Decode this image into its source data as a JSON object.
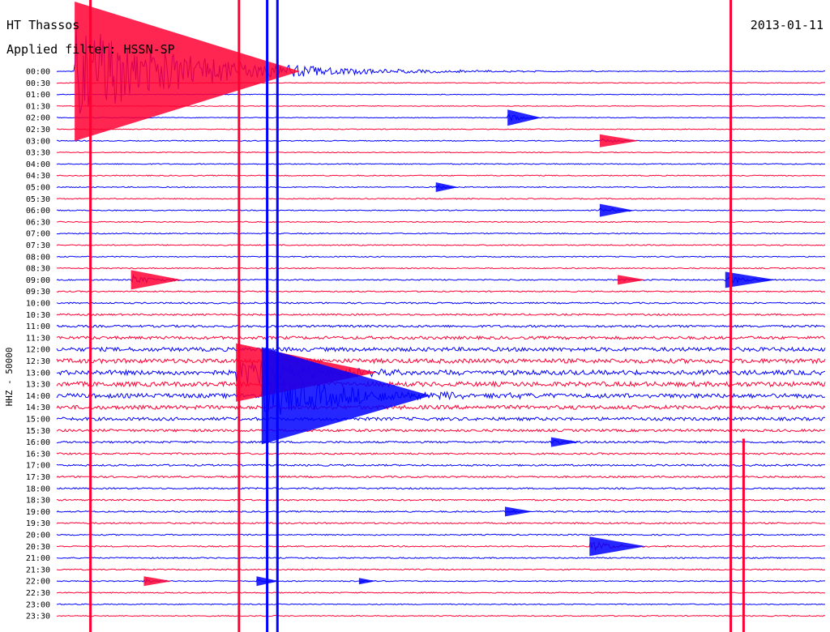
{
  "chart_data": {
    "type": "line",
    "title": "HT Thassos",
    "date": "2013-01-11",
    "filter_label": "Applied filter: HSSN-SP",
    "ylabel": "HHZ - 50000",
    "row_labels": [
      "00:00",
      "00:30",
      "01:00",
      "01:30",
      "02:00",
      "02:30",
      "03:00",
      "03:30",
      "04:00",
      "04:30",
      "05:00",
      "05:30",
      "06:00",
      "06:30",
      "07:00",
      "07:30",
      "08:00",
      "08:30",
      "09:00",
      "09:30",
      "10:00",
      "10:30",
      "11:00",
      "11:30",
      "12:00",
      "12:30",
      "13:00",
      "13:30",
      "14:00",
      "14:30",
      "15:00",
      "15:30",
      "16:00",
      "16:30",
      "17:00",
      "17:30",
      "18:00",
      "18:30",
      "19:00",
      "19:30",
      "20:00",
      "20:30",
      "21:00",
      "21:30",
      "22:00",
      "22:30",
      "23:00",
      "23:30"
    ],
    "row_colors": [
      "#0000ff",
      "#ff0033"
    ],
    "x_minutes": [
      0,
      30
    ],
    "noise_level": [
      0.15,
      0.15,
      0.15,
      0.15,
      0.15,
      0.18,
      0.18,
      0.18,
      0.2,
      0.2,
      0.2,
      0.2,
      0.2,
      0.2,
      0.22,
      0.22,
      0.22,
      0.22,
      0.25,
      0.25,
      0.3,
      0.35,
      0.45,
      0.6,
      0.8,
      0.9,
      0.95,
      0.95,
      0.9,
      0.8,
      0.65,
      0.5,
      0.4,
      0.35,
      0.35,
      0.35,
      0.3,
      0.3,
      0.3,
      0.3,
      0.25,
      0.25,
      0.25,
      0.25,
      0.22,
      0.22,
      0.2,
      0.2
    ],
    "events": [
      {
        "row": 0,
        "minute": 0.7,
        "amplitude": 60,
        "decay": 4,
        "color": "#ff0033"
      },
      {
        "row": 4,
        "minute": 17.6,
        "amplitude": 5,
        "decay": 0.6,
        "color": "#0000ff"
      },
      {
        "row": 6,
        "minute": 21.2,
        "amplitude": 4,
        "decay": 0.7,
        "color": "#ff0033"
      },
      {
        "row": 10,
        "minute": 14.8,
        "amplitude": 3,
        "decay": 0.4,
        "color": "#0000ff"
      },
      {
        "row": 12,
        "minute": 21.2,
        "amplitude": 4,
        "decay": 0.6,
        "color": "#0000ff"
      },
      {
        "row": 18,
        "minute": 2.9,
        "amplitude": 6,
        "decay": 0.9,
        "color": "#ff0033"
      },
      {
        "row": 18,
        "minute": 26.1,
        "amplitude": 5,
        "decay": 0.9,
        "color": "#0000ff"
      },
      {
        "row": 18,
        "minute": 21.9,
        "amplitude": 3,
        "decay": 0.5,
        "color": "#ff0033"
      },
      {
        "row": 26,
        "minute": 7.0,
        "amplitude": 18,
        "decay": 2.5,
        "color": "#ff0033"
      },
      {
        "row": 28,
        "minute": 8.0,
        "amplitude": 30,
        "decay": 3,
        "color": "#0000ff"
      },
      {
        "row": 32,
        "minute": 19.3,
        "amplitude": 3,
        "decay": 0.5,
        "color": "#0000ff"
      },
      {
        "row": 38,
        "minute": 17.5,
        "amplitude": 3,
        "decay": 0.5,
        "color": "#0000ff"
      },
      {
        "row": 41,
        "minute": 20.8,
        "amplitude": 6,
        "decay": 1,
        "color": "#0000ff"
      },
      {
        "row": 44,
        "minute": 3.4,
        "amplitude": 3,
        "decay": 0.5,
        "color": "#ff0033"
      },
      {
        "row": 44,
        "minute": 7.8,
        "amplitude": 3,
        "decay": 0.4,
        "color": "#0000ff"
      },
      {
        "row": 44,
        "minute": 11.8,
        "amplitude": 2,
        "decay": 0.3,
        "color": "#0000ff"
      }
    ],
    "spikes": [
      {
        "minute": 1.3,
        "color": "#ff0033",
        "row_from": 0,
        "row_to": 47
      },
      {
        "minute": 7.1,
        "color": "#ff0033",
        "row_from": 0,
        "row_to": 47
      },
      {
        "minute": 8.2,
        "color": "#0000ff",
        "row_from": 0,
        "row_to": 47
      },
      {
        "minute": 8.6,
        "color": "#0000ff",
        "row_from": 0,
        "row_to": 47
      },
      {
        "minute": 26.3,
        "color": "#ff0033",
        "row_from": 0,
        "row_to": 47
      },
      {
        "minute": 26.8,
        "color": "#ff0033",
        "row_from": 38,
        "row_to": 47
      }
    ]
  }
}
